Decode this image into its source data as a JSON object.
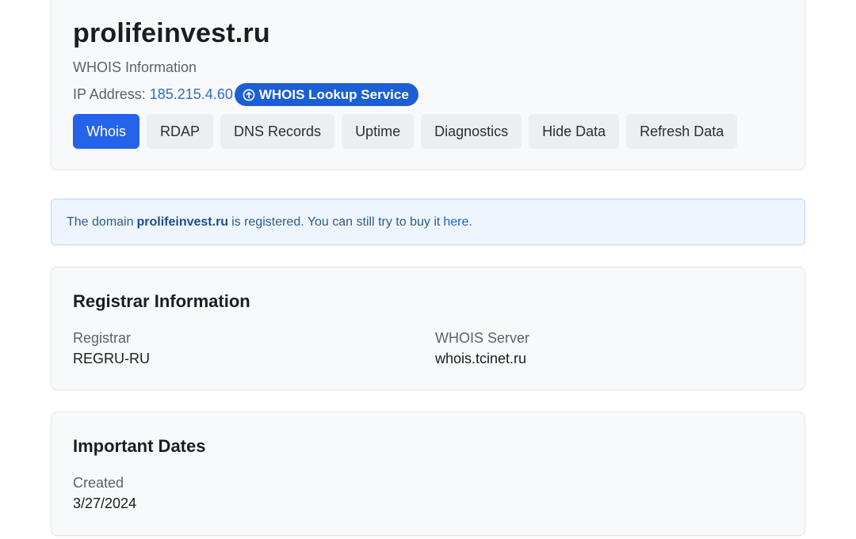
{
  "header": {
    "domain": "prolifeinvest.ru",
    "subtitle": "WHOIS Information",
    "ip_label": "IP Address:",
    "ip_value": "185.215.4.60",
    "service_badge": "WHOIS Lookup Service",
    "tabs": [
      {
        "label": "Whois",
        "active": true
      },
      {
        "label": "RDAP"
      },
      {
        "label": "DNS Records"
      },
      {
        "label": "Uptime"
      },
      {
        "label": "Diagnostics"
      },
      {
        "label": "Hide Data"
      },
      {
        "label": "Refresh Data"
      }
    ]
  },
  "notice": {
    "prefix": "The domain",
    "domain": "prolifeinvest.ru",
    "middle": "is registered. You can still try to buy it",
    "link": "here",
    "suffix": "."
  },
  "registrar": {
    "title": "Registrar Information",
    "registrar_label": "Registrar",
    "registrar_value": "REGRU-RU",
    "server_label": "WHOIS Server",
    "server_value": "whois.tcinet.ru"
  },
  "dates": {
    "title": "Important Dates",
    "created_label": "Created",
    "created_value": "3/27/2024"
  },
  "colors": {
    "accent": "#2563eb",
    "badge": "#1c5fd4",
    "link": "#2f6fbd",
    "notice_bg": "#eef5fe"
  }
}
